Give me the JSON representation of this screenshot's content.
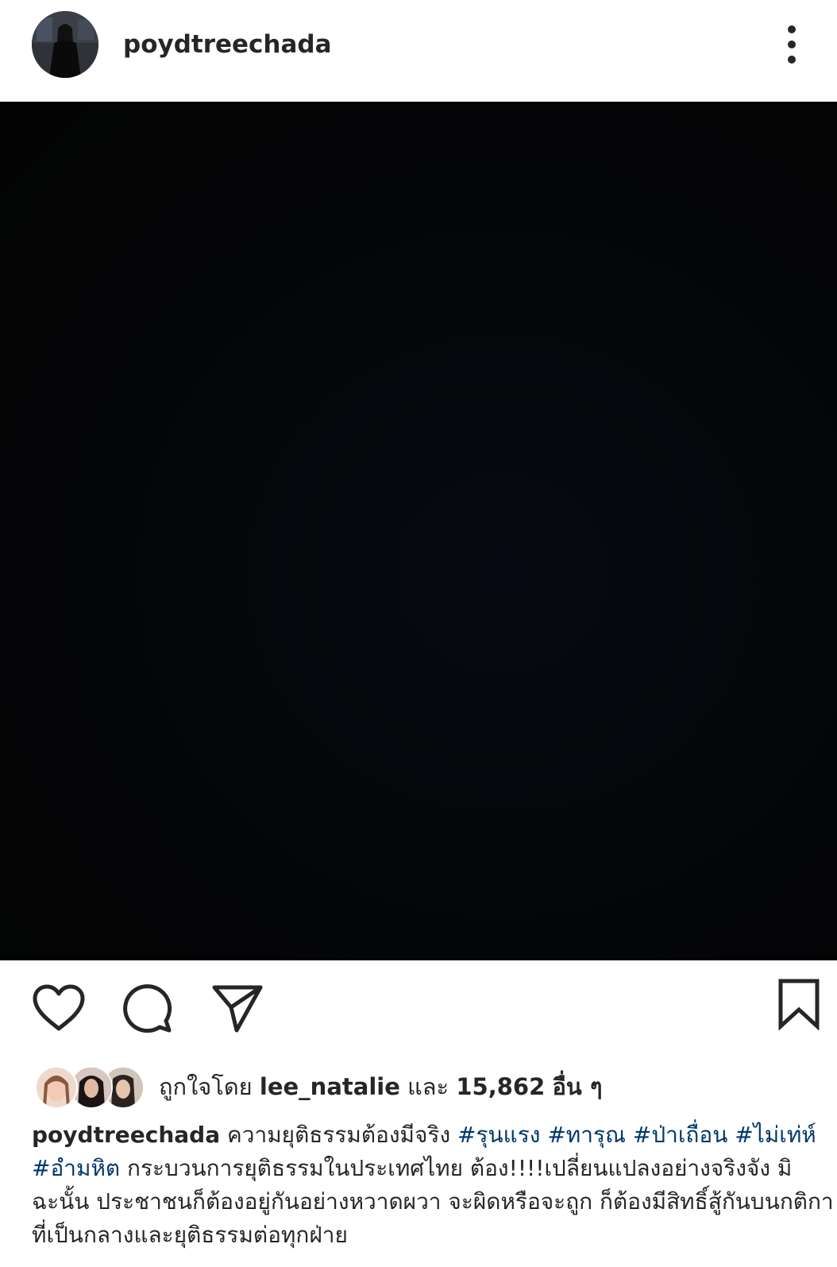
{
  "post": {
    "username": "poydtreechada"
  },
  "likes": {
    "prefix": "ถูกใจโดย",
    "liker": "lee_natalie",
    "connector": "และ",
    "count": "15,862",
    "suffix": "อื่น ๆ"
  },
  "caption": {
    "username": "poydtreechada",
    "text_1": " ความยุติธรรมต้องมีจริง ",
    "tags_1": [
      "#รุนแรง",
      "#ทารุณ",
      "#ป่าเถื่อน",
      "#ไม่เท่ห์",
      "#อำมหิต"
    ],
    "text_2": " กระบวนการยุติธรรมในประเทศไทย ต้อง!!!!เปลี่ยนแปลงอย่างจริงจัง มิฉะนั้น ประชาชนก็ต้องอยู่กันอย่างหวาดผวา จะผิดหรือจะถูก ก็ต้องมีสิทธิ์สู้กันบนกติกาที่เป็นกลางและยุติธรรมต่อทุกฝ่าย"
  },
  "icons": {
    "more": "more-vertical-icon",
    "like": "heart-icon",
    "comment": "comment-icon",
    "share": "paper-plane-icon",
    "save": "bookmark-icon"
  },
  "colors": {
    "text": "#262626",
    "hashtag": "#00376b",
    "media_background": "#030303"
  }
}
